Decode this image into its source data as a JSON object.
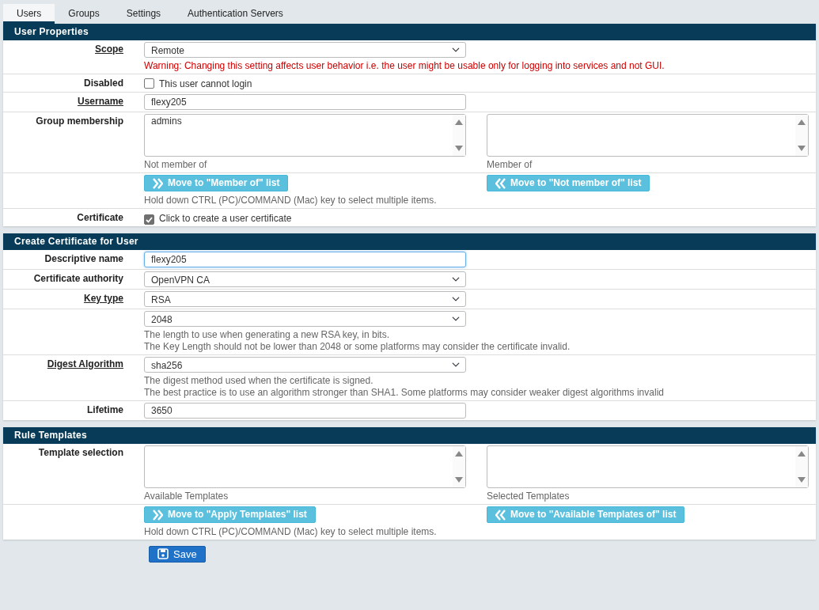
{
  "tabs": [
    {
      "label": "Users",
      "selected": true
    },
    {
      "label": "Groups",
      "selected": false
    },
    {
      "label": "Settings",
      "selected": false
    },
    {
      "label": "Authentication Servers",
      "selected": false
    }
  ],
  "sections": [
    {
      "title": "User Properties",
      "rows": [
        {
          "kind": "select",
          "label": "Scope",
          "underlined": true,
          "value": "Remote",
          "warning": "Warning: Changing this setting affects user behavior i.e. the user might be usable only for logging into services and not GUI."
        },
        {
          "kind": "checkbox",
          "label": "Disabled",
          "underlined": false,
          "checked": false,
          "text": "This user cannot login"
        },
        {
          "kind": "text",
          "label": "Username",
          "underlined": true,
          "value": "flexy205",
          "focused": false
        },
        {
          "kind": "dual-list",
          "label": "Group membership",
          "underlined": false,
          "left": {
            "items": [
              "admins"
            ],
            "caption": "Not member of"
          },
          "right": {
            "caption": "Member of"
          }
        },
        {
          "kind": "move-buttons",
          "buttons": [
            {
              "text": "Move to \"Member of\" list",
              "kind": "add"
            },
            {
              "text": "Move to \"Not member of\" list",
              "kind": "remove"
            }
          ],
          "help": [
            "Hold down CTRL (PC)/COMMAND (Mac) key to select multiple items."
          ]
        },
        {
          "kind": "checkbox",
          "label": "Certificate",
          "underlined": false,
          "checked": true,
          "text": "Click to create a user certificate"
        }
      ]
    },
    {
      "title": "Create Certificate for User",
      "rows": [
        {
          "kind": "text",
          "label": "Descriptive name",
          "underlined": false,
          "value": "flexy205",
          "focused": true
        },
        {
          "kind": "select",
          "label": "Certificate authority",
          "underlined": false,
          "value": "OpenVPN CA"
        },
        {
          "kind": "select",
          "label": "Key type",
          "underlined": true,
          "value": "RSA"
        },
        {
          "kind": "select",
          "value": "2048",
          "help": [
            "The length to use when generating a new RSA key, in bits.",
            "The Key Length should not be lower than 2048 or some platforms may consider the certificate invalid."
          ]
        },
        {
          "kind": "select",
          "label": "Digest Algorithm",
          "underlined": true,
          "value": "sha256",
          "help": [
            "The digest method used when the certificate is signed.",
            "The best practice is to use an algorithm stronger than SHA1. Some platforms may consider weaker digest algorithms invalid"
          ]
        },
        {
          "kind": "text",
          "label": "Lifetime",
          "underlined": false,
          "value": "3650",
          "focused": false
        }
      ]
    },
    {
      "title": "Rule Templates",
      "rows": [
        {
          "kind": "dual-list",
          "label": "Template selection",
          "underlined": false,
          "left": {
            "caption": "Available Templates"
          },
          "right": {
            "caption": "Selected Templates"
          }
        },
        {
          "kind": "move-buttons",
          "buttons": [
            {
              "text": "Move to \"Apply Templates\" list",
              "kind": "add"
            },
            {
              "text": "Move to \"Available Templates of\" list",
              "kind": "remove"
            }
          ],
          "help": [
            "Hold down CTRL (PC)/COMMAND (Mac) key to select multiple items."
          ]
        }
      ]
    }
  ],
  "save_button": {
    "text": "Save"
  }
}
